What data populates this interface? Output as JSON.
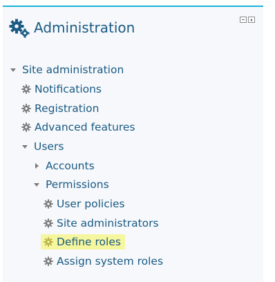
{
  "block": {
    "title": "Administration",
    "icon": "gears-icon",
    "controls": [
      {
        "name": "hide-block-icon"
      },
      {
        "name": "dock-block-icon"
      }
    ]
  },
  "tree": {
    "site_admin": {
      "label": "Site administration",
      "icon": "caret-down-icon"
    },
    "notifications": {
      "label": "Notifications",
      "icon": "gear-icon"
    },
    "registration": {
      "label": "Registration",
      "icon": "gear-icon"
    },
    "advanced_features": {
      "label": "Advanced features",
      "icon": "gear-icon"
    },
    "users": {
      "label": "Users",
      "icon": "caret-down-icon"
    },
    "accounts": {
      "label": "Accounts",
      "icon": "caret-right-icon"
    },
    "permissions": {
      "label": "Permissions",
      "icon": "caret-down-icon"
    },
    "user_policies": {
      "label": "User policies",
      "icon": "gear-icon"
    },
    "site_administrators": {
      "label": "Site administrators",
      "icon": "gear-icon"
    },
    "define_roles": {
      "label": "Define roles",
      "icon": "gear-icon",
      "highlighted": true
    },
    "assign_system_roles": {
      "label": "Assign system roles",
      "icon": "gear-icon"
    }
  },
  "colors": {
    "accent_border": "#1ab3d8",
    "link": "#1a5a83",
    "highlight": "#f6f69e",
    "icon_gray": "#7b7b7b"
  }
}
